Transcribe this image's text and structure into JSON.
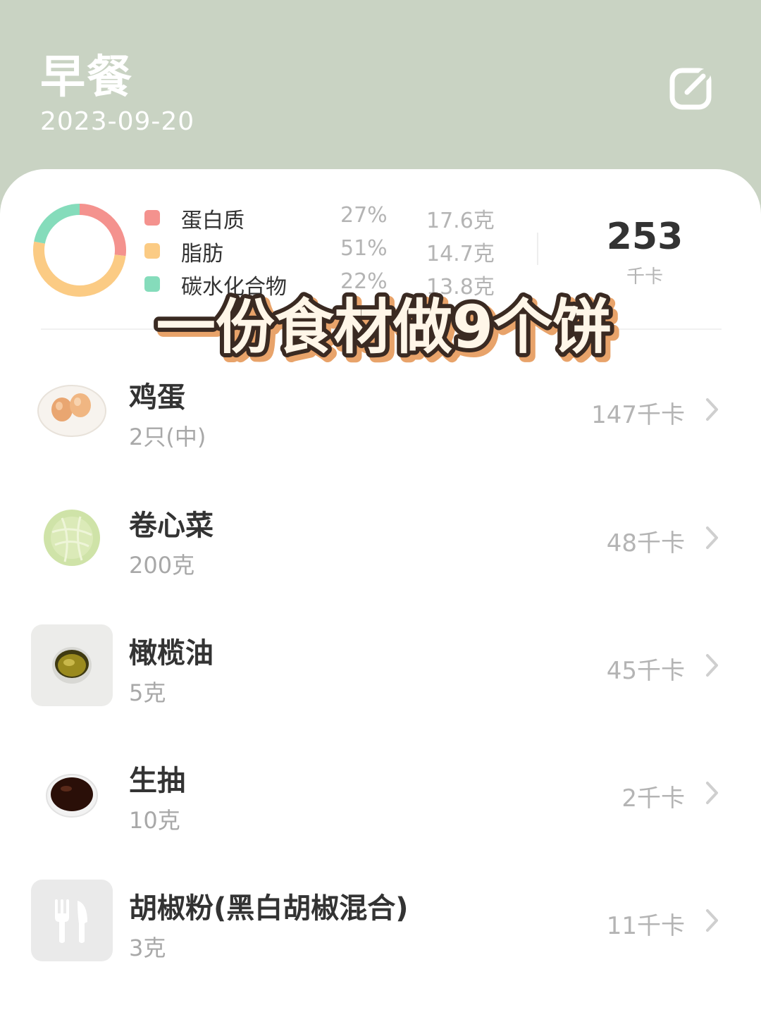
{
  "header": {
    "title": "早餐",
    "date": "2023-09-20",
    "edit_icon": "edit-square-icon"
  },
  "nutrition": {
    "items": [
      {
        "name": "蛋白质",
        "percent": "27%",
        "amount": "17.6克",
        "color": "#f4928e",
        "fraction": 0.27
      },
      {
        "name": "脂肪",
        "percent": "51%",
        "amount": "14.7克",
        "color": "#fbcb84",
        "fraction": 0.51
      },
      {
        "name": "碳水化合物",
        "percent": "22%",
        "amount": "13.8克",
        "color": "#85dcbb",
        "fraction": 0.22
      }
    ],
    "total_value": "253",
    "total_unit": "千卡"
  },
  "overlay_caption": "一份食材做9个饼",
  "foods": [
    {
      "name": "鸡蛋",
      "quantity": "2只(中)",
      "kcal": "147千卡",
      "icon": "eggs-photo"
    },
    {
      "name": "卷心菜",
      "quantity": "200克",
      "kcal": "48千卡",
      "icon": "cabbage-photo"
    },
    {
      "name": "橄榄油",
      "quantity": "5克",
      "kcal": "45千卡",
      "icon": "olive-oil-photo"
    },
    {
      "name": "生抽",
      "quantity": "10克",
      "kcal": "2千卡",
      "icon": "soy-sauce-photo"
    },
    {
      "name": "胡椒粉(黑白胡椒混合)",
      "quantity": "3克",
      "kcal": "11千卡",
      "icon": "fork-knife-icon"
    }
  ]
}
